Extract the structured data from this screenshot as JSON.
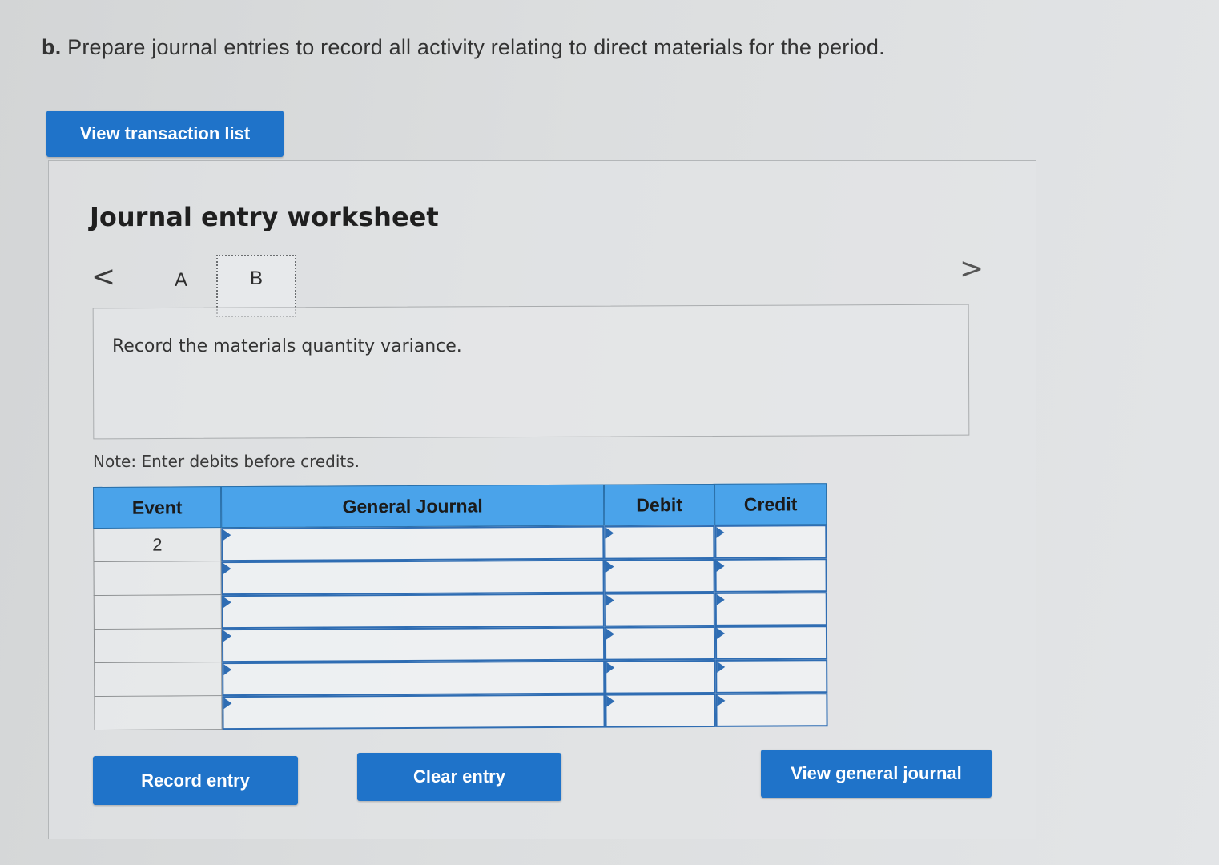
{
  "question": {
    "letter": "b.",
    "text": "Prepare journal entries to record all activity relating to direct materials for the period."
  },
  "buttons": {
    "view_transactions": "View transaction list",
    "record_entry": "Record entry",
    "clear_entry": "Clear entry",
    "view_general_journal": "View general journal"
  },
  "worksheet": {
    "title": "Journal entry worksheet",
    "prev_glyph": "<",
    "next_glyph": ">",
    "tabs": [
      {
        "label": "A",
        "active": false
      },
      {
        "label": "B",
        "active": true
      }
    ],
    "instruction": "Record the materials quantity variance.",
    "note": "Note: Enter debits before credits."
  },
  "journal": {
    "headers": {
      "event": "Event",
      "general_journal": "General Journal",
      "debit": "Debit",
      "credit": "Credit"
    },
    "rows": [
      {
        "event": "2",
        "account": "",
        "debit": "",
        "credit": ""
      },
      {
        "event": "",
        "account": "",
        "debit": "",
        "credit": ""
      },
      {
        "event": "",
        "account": "",
        "debit": "",
        "credit": ""
      },
      {
        "event": "",
        "account": "",
        "debit": "",
        "credit": ""
      },
      {
        "event": "",
        "account": "",
        "debit": "",
        "credit": ""
      },
      {
        "event": "",
        "account": "",
        "debit": "",
        "credit": ""
      }
    ]
  },
  "colors": {
    "button": "#1f73c9",
    "header": "#4aa3ea",
    "input_border": "#2f6db3"
  }
}
